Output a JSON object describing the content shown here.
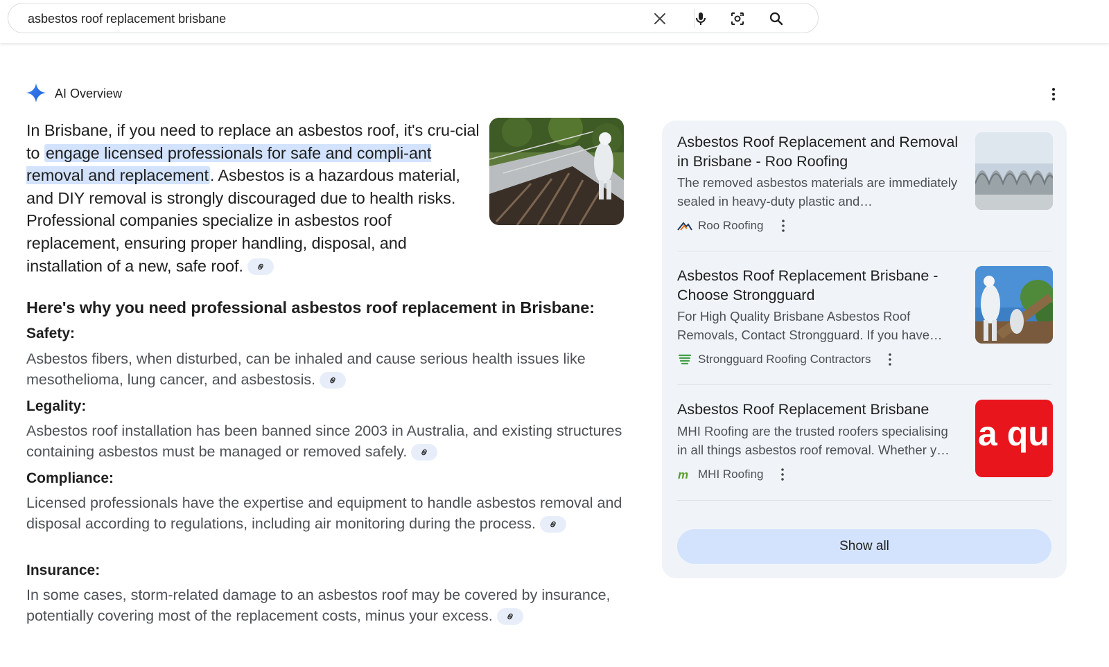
{
  "search": {
    "query": "asbestos roof replacement brisbane"
  },
  "ai_overview": {
    "title": "AI Overview",
    "intro_part1": "In Brisbane, if you need to replace an asbestos roof, it's cru-cial to ",
    "intro_highlight": "engage licensed professionals for safe and compli-ant removal and replacement",
    "intro_part2": ". Asbestos is a hazardous material, and DIY removal is strongly discouraged due to health risks. Professional companies specialize in asbestos roof replacement, ensuring proper handling, disposal, and installation of a new, safe roof.",
    "why_heading": "Here's why you need professional asbestos roof replacement in Brisbane:",
    "reasons": [
      {
        "heading": "Safety:",
        "text": "Asbestos fibers, when disturbed, can be inhaled and cause serious health issues like mesothelioma, lung cancer, and asbestosis."
      },
      {
        "heading": "Legality:",
        "text": "Asbestos roof installation has been banned since 2003 in Australia, and existing structures containing asbestos must be managed or removed safely."
      },
      {
        "heading": "Compliance:",
        "text": "Licensed professionals have the expertise and equipment to handle asbestos removal and disposal according to regulations, including air monitoring during the process."
      },
      {
        "heading": "Insurance:",
        "text": "In some cases, storm-related damage to an asbestos roof may be covered by insurance, potentially covering most of the replacement costs, minus your excess."
      }
    ]
  },
  "sources": [
    {
      "title": "Asbestos Roof Replacement and Removal in Brisbane - Roo Roofing",
      "desc": "The removed asbestos materials are immediately sealed in heavy-duty plastic and…",
      "site": "Roo Roofing"
    },
    {
      "title": "Asbestos Roof Replacement Brisbane - Choose Strongguard",
      "desc": "For High Quality Brisbane Asbestos Roof Removals, Contact Strongguard. If you have…",
      "site": "Strongguard Roofing Contractors"
    },
    {
      "title": "Asbestos Roof Replacement Brisbane",
      "desc": "MHI Roofing are the trusted roofers specialising in all things asbestos roof removal. Whether y…",
      "site": "MHI Roofing",
      "thumb_text": "a qu"
    }
  ],
  "show_all_label": "Show all",
  "colors": {
    "highlight": "#d3e3fd",
    "panel_bg": "#f0f4f9",
    "accent_blue": "#1a73e8",
    "thumb_red": "#e8161c"
  }
}
